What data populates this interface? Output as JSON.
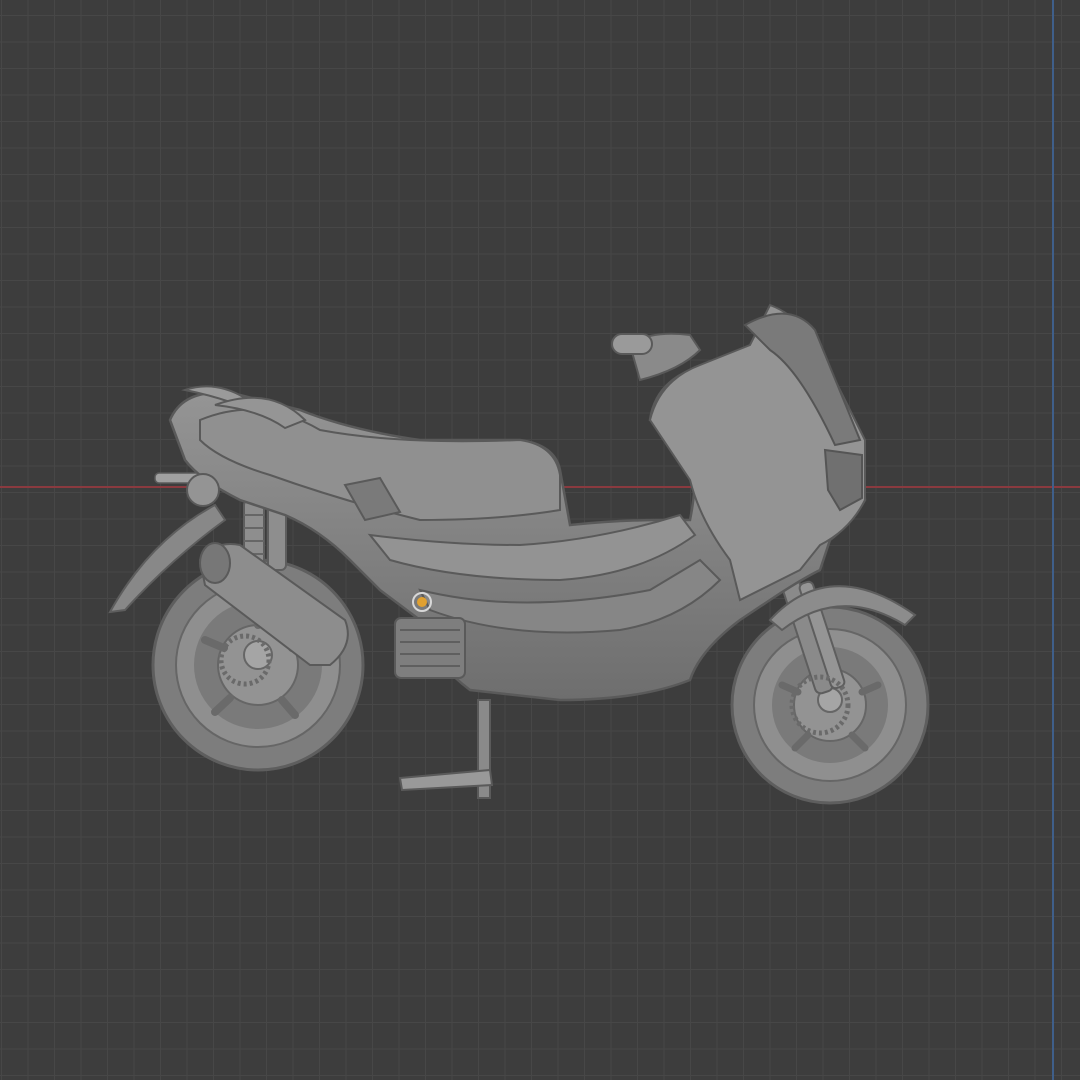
{
  "viewport": {
    "background_color": "#3d3d3d",
    "grid_color": "#474747",
    "x_axis_color": "#8a3a3f",
    "y_axis_color": "#3f5f8a"
  },
  "model": {
    "icon": "scooter-model",
    "material_color": "#8c8c8c",
    "origin_marker_color": "#e0a030"
  }
}
